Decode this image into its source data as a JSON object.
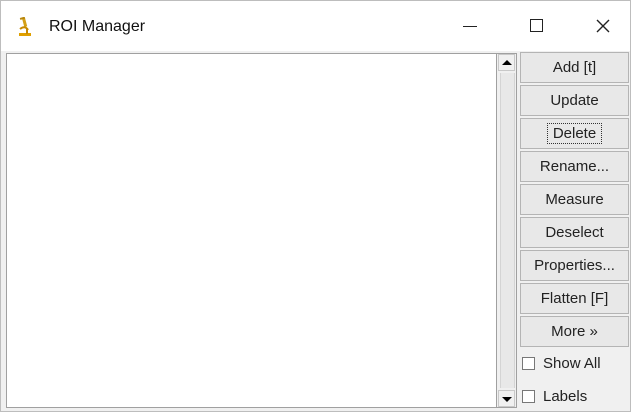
{
  "window": {
    "title": "ROI Manager",
    "controls": {
      "minimize": "—",
      "maximize": "☐",
      "close": "✕"
    }
  },
  "icons": {
    "app": "microscope-icon"
  },
  "roi_list": {
    "items": []
  },
  "buttons": [
    {
      "id": "add",
      "label": "Add [t]"
    },
    {
      "id": "update",
      "label": "Update"
    },
    {
      "id": "delete",
      "label": "Delete",
      "focused": true
    },
    {
      "id": "rename",
      "label": "Rename..."
    },
    {
      "id": "measure",
      "label": "Measure"
    },
    {
      "id": "deselect",
      "label": "Deselect"
    },
    {
      "id": "properties",
      "label": "Properties..."
    },
    {
      "id": "flatten",
      "label": "Flatten [F]"
    },
    {
      "id": "more",
      "label": "More »"
    }
  ],
  "checkboxes": [
    {
      "id": "show-all",
      "label": "Show All",
      "checked": false
    },
    {
      "id": "labels",
      "label": "Labels",
      "checked": false
    }
  ]
}
